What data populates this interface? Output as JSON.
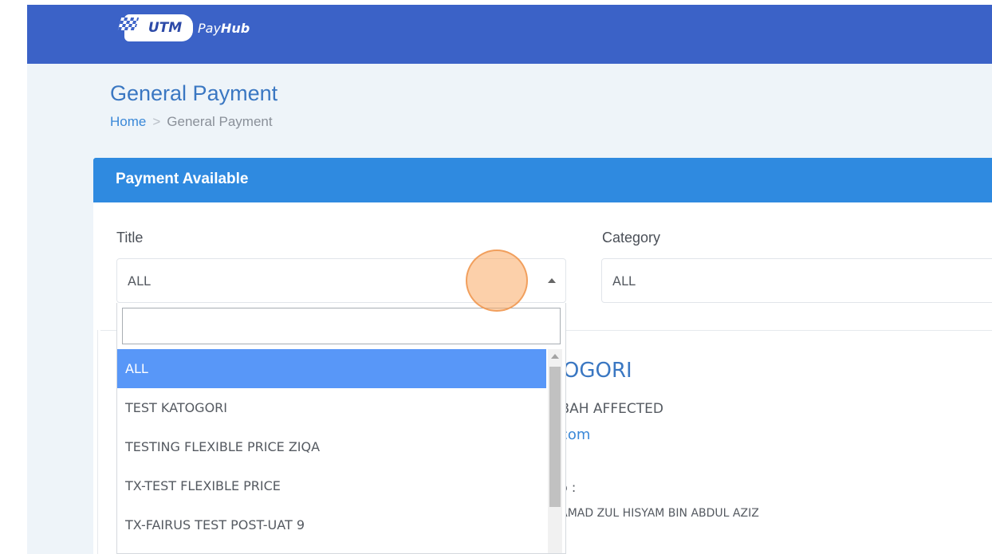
{
  "header": {
    "logo_badge": "UTM",
    "logo_pay": "Pay",
    "logo_hub": "Hub"
  },
  "page": {
    "title": "General Payment",
    "breadcrumb": {
      "home": "Home",
      "separator": ">",
      "current": "General Payment"
    }
  },
  "card": {
    "header": "Payment Available",
    "filters": {
      "title_label": "Title",
      "title_value": "ALL",
      "category_label": "Category",
      "category_value": "ALL"
    }
  },
  "dropdown": {
    "search_value": "",
    "items": [
      "ALL",
      "TEST KATOGORI",
      "TESTING FLEXIBLE PRICE ZIQA",
      "TX-TEST FLEXIBLE PRICE",
      "TX-FAIRUS TEST POST-UAT 9"
    ],
    "selected_index": 0
  },
  "background_content": {
    "heading_fragment": "TOGORI",
    "line1_fragment": "UBAH AFFECTED",
    "link_fragment": "com",
    "label_fragment": "o :",
    "name_fragment": "IAMAD ZUL HISYAM BIN ABDUL AZIZ"
  },
  "colors": {
    "topbar": "#3b62c7",
    "card_header": "#2f8ae0",
    "selected_item": "#5897f8",
    "title_text": "#3a77c2",
    "link": "#3a88d8"
  }
}
